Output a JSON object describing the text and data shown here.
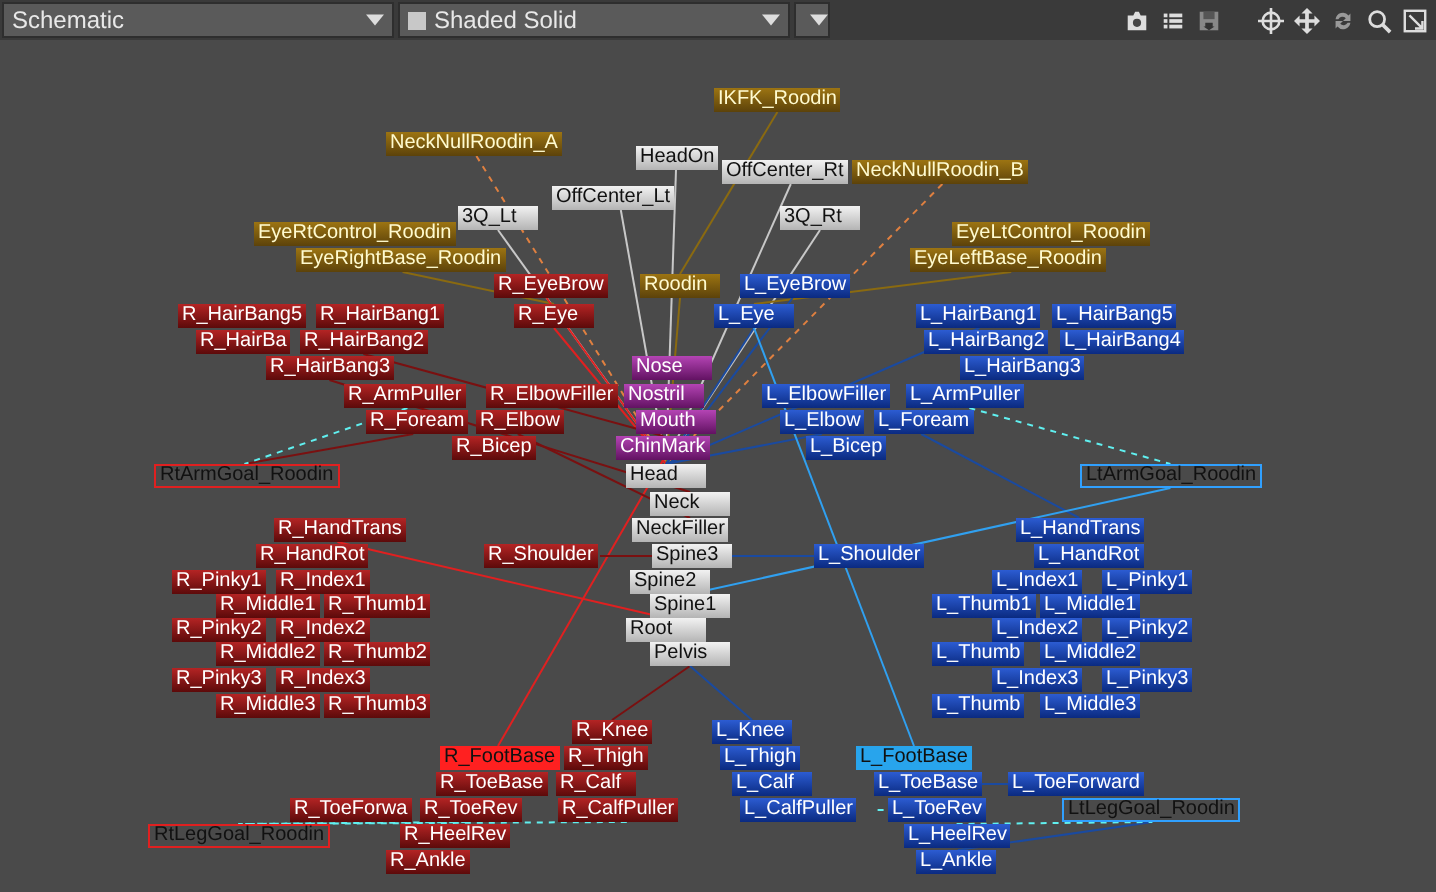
{
  "toolbar": {
    "view_menu": "Schematic",
    "shading_menu": "Shaded Solid"
  },
  "nodes": [
    {
      "label": "IKFK_Roodin",
      "kind": "control",
      "selected": false
    },
    {
      "label": "NeckNullRoodin_A",
      "kind": "control",
      "selected": false
    },
    {
      "label": "HeadOn",
      "kind": "center",
      "selected": false
    },
    {
      "label": "OffCenter_Rt",
      "kind": "center",
      "selected": false
    },
    {
      "label": "NeckNullRoodin_B",
      "kind": "control",
      "selected": false
    },
    {
      "label": "OffCenter_Lt",
      "kind": "center",
      "selected": false
    },
    {
      "label": "3Q_Lt",
      "kind": "center",
      "selected": false
    },
    {
      "label": "3Q_Rt",
      "kind": "center",
      "selected": false
    },
    {
      "label": "EyeRtControl_Roodin",
      "kind": "control",
      "selected": false
    },
    {
      "label": "EyeLtControl_Roodin",
      "kind": "control",
      "selected": false
    },
    {
      "label": "EyeRightBase_Roodin",
      "kind": "control",
      "selected": false
    },
    {
      "label": "EyeLeftBase_Roodin",
      "kind": "control",
      "selected": false
    },
    {
      "label": "R_EyeBrow",
      "kind": "right",
      "selected": false
    },
    {
      "label": "Roodin",
      "kind": "control",
      "selected": false
    },
    {
      "label": "L_EyeBrow",
      "kind": "left",
      "selected": false
    },
    {
      "label": "R_HairBang5",
      "kind": "right",
      "selected": false
    },
    {
      "label": "R_HairBang1",
      "kind": "right",
      "selected": false
    },
    {
      "label": "R_Eye",
      "kind": "right",
      "selected": false
    },
    {
      "label": "L_Eye",
      "kind": "left",
      "selected": false
    },
    {
      "label": "L_HairBang1",
      "kind": "left",
      "selected": false
    },
    {
      "label": "L_HairBang5",
      "kind": "left",
      "selected": false
    },
    {
      "label": "R_HairBa",
      "kind": "right",
      "selected": false
    },
    {
      "label": "R_HairBang2",
      "kind": "right",
      "selected": false
    },
    {
      "label": "L_HairBang2",
      "kind": "left",
      "selected": false
    },
    {
      "label": "L_HairBang4",
      "kind": "left",
      "selected": false
    },
    {
      "label": "R_HairBang3",
      "kind": "right",
      "selected": false
    },
    {
      "label": "Nose",
      "kind": "face",
      "selected": false
    },
    {
      "label": "L_HairBang3",
      "kind": "left",
      "selected": false
    },
    {
      "label": "R_ArmPuller",
      "kind": "right",
      "selected": false
    },
    {
      "label": "R_ElbowFiller",
      "kind": "right",
      "selected": false
    },
    {
      "label": "Nostril",
      "kind": "face",
      "selected": false
    },
    {
      "label": "L_ElbowFiller",
      "kind": "left",
      "selected": false
    },
    {
      "label": "L_ArmPuller",
      "kind": "left",
      "selected": false
    },
    {
      "label": "R_Foream",
      "kind": "right",
      "selected": false
    },
    {
      "label": "R_Elbow",
      "kind": "right",
      "selected": false
    },
    {
      "label": "Mouth",
      "kind": "face",
      "selected": false
    },
    {
      "label": "L_Elbow",
      "kind": "left",
      "selected": false
    },
    {
      "label": "L_Foream",
      "kind": "left",
      "selected": false
    },
    {
      "label": "R_Bicep",
      "kind": "right",
      "selected": false
    },
    {
      "label": "ChinMark",
      "kind": "face",
      "selected": false
    },
    {
      "label": "L_Bicep",
      "kind": "left",
      "selected": false
    },
    {
      "label": "RtArmGoal_Roodin",
      "kind": "rightgoal",
      "selected": false
    },
    {
      "label": "Head",
      "kind": "center",
      "selected": false
    },
    {
      "label": "LtArmGoal_Roodin",
      "kind": "leftgoal",
      "selected": false
    },
    {
      "label": "Neck",
      "kind": "center",
      "selected": false
    },
    {
      "label": "R_HandTrans",
      "kind": "right",
      "selected": false
    },
    {
      "label": "NeckFiller",
      "kind": "center",
      "selected": false
    },
    {
      "label": "L_HandTrans",
      "kind": "left",
      "selected": false
    },
    {
      "label": "R_HandRot",
      "kind": "right",
      "selected": false
    },
    {
      "label": "R_Shoulder",
      "kind": "right",
      "selected": false
    },
    {
      "label": "Spine3",
      "kind": "center",
      "selected": false
    },
    {
      "label": "L_Shoulder",
      "kind": "left",
      "selected": false
    },
    {
      "label": "L_HandRot",
      "kind": "left",
      "selected": false
    },
    {
      "label": "R_Pinky1",
      "kind": "right",
      "selected": false
    },
    {
      "label": "R_Index1",
      "kind": "right",
      "selected": false
    },
    {
      "label": "Spine2",
      "kind": "center",
      "selected": false
    },
    {
      "label": "L_Index1",
      "kind": "left",
      "selected": false
    },
    {
      "label": "L_Pinky1",
      "kind": "left",
      "selected": false
    },
    {
      "label": "R_Middle1",
      "kind": "right",
      "selected": false
    },
    {
      "label": "R_Thumb1",
      "kind": "right",
      "selected": false
    },
    {
      "label": "Spine1",
      "kind": "center",
      "selected": false
    },
    {
      "label": "L_Thumb1",
      "kind": "left",
      "selected": false
    },
    {
      "label": "L_Middle1",
      "kind": "left",
      "selected": false
    },
    {
      "label": "R_Pinky2",
      "kind": "right",
      "selected": false
    },
    {
      "label": "R_Index2",
      "kind": "right",
      "selected": false
    },
    {
      "label": "Root",
      "kind": "center",
      "selected": false
    },
    {
      "label": "L_Index2",
      "kind": "left",
      "selected": false
    },
    {
      "label": "L_Pinky2",
      "kind": "left",
      "selected": false
    },
    {
      "label": "R_Middle2",
      "kind": "right",
      "selected": false
    },
    {
      "label": "R_Thumb2",
      "kind": "right",
      "selected": false
    },
    {
      "label": "Pelvis",
      "kind": "center",
      "selected": false
    },
    {
      "label": "L_Thumb",
      "kind": "left",
      "selected": false
    },
    {
      "label": "L_Middle2",
      "kind": "left",
      "selected": false
    },
    {
      "label": "R_Pinky3",
      "kind": "right",
      "selected": false
    },
    {
      "label": "R_Index3",
      "kind": "right",
      "selected": false
    },
    {
      "label": "L_Index3",
      "kind": "left",
      "selected": false
    },
    {
      "label": "L_Pinky3",
      "kind": "left",
      "selected": false
    },
    {
      "label": "R_Middle3",
      "kind": "right",
      "selected": false
    },
    {
      "label": "R_Thumb3",
      "kind": "right",
      "selected": false
    },
    {
      "label": "L_Thumb",
      "kind": "left",
      "selected": false
    },
    {
      "label": "L_Middle3",
      "kind": "left",
      "selected": false
    },
    {
      "label": "R_Knee",
      "kind": "right",
      "selected": false
    },
    {
      "label": "L_Knee",
      "kind": "left",
      "selected": false
    },
    {
      "label": "R_FootBase",
      "kind": "right",
      "selected": true
    },
    {
      "label": "R_Thigh",
      "kind": "right",
      "selected": false
    },
    {
      "label": "L_Thigh",
      "kind": "left",
      "selected": false
    },
    {
      "label": "L_FootBase",
      "kind": "left",
      "selected": true
    },
    {
      "label": "R_ToeBase",
      "kind": "right",
      "selected": false
    },
    {
      "label": "R_Calf",
      "kind": "right",
      "selected": false
    },
    {
      "label": "L_Calf",
      "kind": "left",
      "selected": false
    },
    {
      "label": "L_ToeBase",
      "kind": "left",
      "selected": false
    },
    {
      "label": "L_ToeForward",
      "kind": "left",
      "selected": false
    },
    {
      "label": "R_ToeForwa",
      "kind": "right",
      "selected": false
    },
    {
      "label": "R_ToeRev",
      "kind": "right",
      "selected": false
    },
    {
      "label": "R_CalfPuller",
      "kind": "right",
      "selected": false
    },
    {
      "label": "L_CalfPuller",
      "kind": "left",
      "selected": false
    },
    {
      "label": "L_ToeRev",
      "kind": "left",
      "selected": false
    },
    {
      "label": "LtLegGoal_Roodin",
      "kind": "leftgoal",
      "selected": false
    },
    {
      "label": "RtLegGoal_Roodin",
      "kind": "rightgoal",
      "selected": false
    },
    {
      "label": "R_HeelRev",
      "kind": "right",
      "selected": false
    },
    {
      "label": "L_HeelRev",
      "kind": "left",
      "selected": false
    },
    {
      "label": "R_Ankle",
      "kind": "right",
      "selected": false
    },
    {
      "label": "L_Ankle",
      "kind": "left",
      "selected": false
    }
  ]
}
